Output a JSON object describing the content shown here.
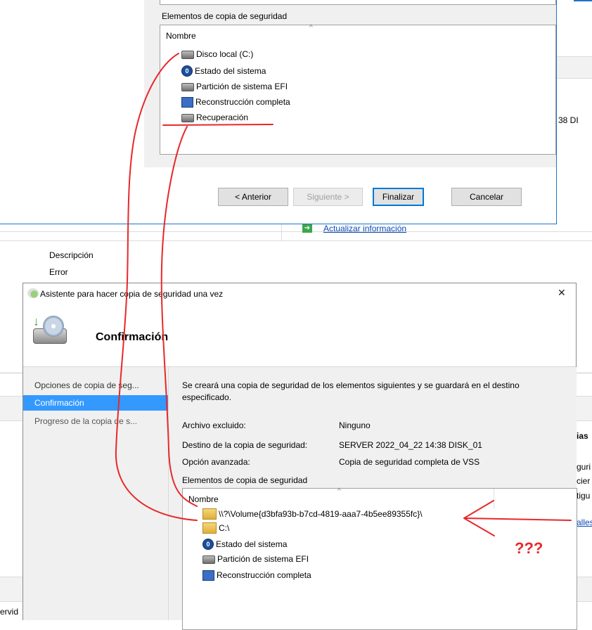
{
  "top_wizard": {
    "items_label": "Elementos de copia de seguridad",
    "column_name": "Nombre",
    "items": [
      {
        "icon": "disk-icon",
        "label": "Disco local (C:)"
      },
      {
        "icon": "system-state-icon",
        "label": "Estado del sistema"
      },
      {
        "icon": "disk-icon",
        "label": "Partición de sistema EFI"
      },
      {
        "icon": "bare-metal-icon",
        "label": "Reconstrucción completa"
      },
      {
        "icon": "disk-icon",
        "label": "Recuperación"
      }
    ],
    "buttons": {
      "back": "< Anterior",
      "next": "Siguiente >",
      "finish": "Finalizar",
      "cancel": "Cancelar"
    },
    "right_edge_text": "38 DI"
  },
  "background": {
    "update_link": "Actualizar información",
    "description_label": "Descripción",
    "error_label": "Error",
    "right_edge_snippets": [
      "ias",
      "guri",
      "cier",
      "tigu",
      "alles"
    ],
    "bottom_left_snippet": "ervid"
  },
  "dialog": {
    "title": "Asistente para hacer copia de seguridad una vez",
    "close_glyph": "✕",
    "header_title": "Confirmación",
    "nav": [
      {
        "label": "Opciones de copia de seg...",
        "state": "normal"
      },
      {
        "label": "Confirmación",
        "state": "active"
      },
      {
        "label": "Progreso de la copia de s...",
        "state": "dim"
      }
    ],
    "intro": "Se creará una copia de seguridad de los elementos siguientes y se guardará en el destino especificado.",
    "fields": [
      {
        "label": "Archivo excluido:",
        "value": "Ninguno"
      },
      {
        "label": "Destino de la copia de seguridad:",
        "value": "SERVER 2022_04_22 14:38 DISK_01"
      },
      {
        "label": "Opción avanzada:",
        "value": "Copia de seguridad completa de VSS"
      }
    ],
    "items_label": "Elementos de copia de seguridad",
    "column_name": "Nombre",
    "items": [
      {
        "icon": "folder-icon",
        "label": "\\\\?\\Volume{d3bfa93b-b7cd-4819-aaa7-4b5ee89355fc}\\"
      },
      {
        "icon": "folder-icon",
        "label": "C:\\"
      },
      {
        "icon": "system-state-icon",
        "label": "Estado del sistema"
      },
      {
        "icon": "disk-icon",
        "label": "Partición de sistema EFI"
      },
      {
        "icon": "bare-metal-icon",
        "label": "Reconstrucción completa"
      }
    ]
  },
  "annotations": {
    "question_marks": "???",
    "color": "#e8282b"
  }
}
